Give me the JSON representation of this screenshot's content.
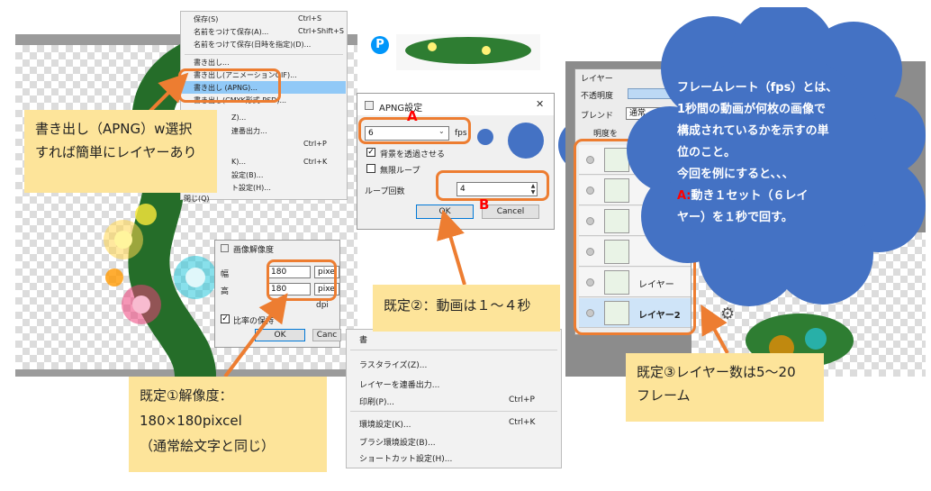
{
  "file_menu_top": {
    "items": [
      {
        "label": "保存(S)",
        "shortcut": "Ctrl+S"
      },
      {
        "label": "名前をつけて保存(A)...",
        "shortcut": "Ctrl+Shift+S"
      },
      {
        "label": "名前をつけて保存(日時を指定)(D)...",
        "shortcut": ""
      },
      {
        "label": "書き出し...",
        "shortcut": ""
      },
      {
        "label": "書き出し(アニメーションGIF)...",
        "shortcut": ""
      },
      {
        "label": "書き出し (APNG)...",
        "shortcut": ""
      },
      {
        "label": "書き出し(CMYK形式 PSD)...",
        "shortcut": ""
      },
      {
        "label": "Z)...",
        "shortcut": ""
      },
      {
        "label": "連番出力...",
        "shortcut": ""
      },
      {
        "label": "",
        "shortcut": "Ctrl+P"
      },
      {
        "label": "K)...",
        "shortcut": "Ctrl+K"
      },
      {
        "label": "設定(B)...",
        "shortcut": ""
      },
      {
        "label": "ト設定(H)...",
        "shortcut": ""
      },
      {
        "label": "閉じ(Q)",
        "shortcut": ""
      }
    ]
  },
  "file_menu_bottom": {
    "items": [
      {
        "label": "書",
        "shortcut": ""
      },
      {
        "label": "ラスタライズ(Z)...",
        "shortcut": ""
      },
      {
        "label": "レイヤーを連番出力...",
        "shortcut": ""
      },
      {
        "label": "印刷(P)...",
        "shortcut": "Ctrl+P"
      },
      {
        "label": "環境設定(K)...",
        "shortcut": "Ctrl+K"
      },
      {
        "label": "ブラシ環境設定(B)...",
        "shortcut": ""
      },
      {
        "label": "ショートカット設定(H)...",
        "shortcut": ""
      }
    ]
  },
  "apng_dialog": {
    "title": "APNG設定",
    "close": "✕",
    "fps_value": "6",
    "fps_unit": "fps",
    "bg_transparent": "背景を透過させる",
    "infinite_loop": "無限ループ",
    "loop_count_label": "ループ回数",
    "loop_count_value": "4",
    "ok": "OK",
    "cancel": "Cancel"
  },
  "resize_dialog": {
    "title": "画像解像度",
    "width_label": "幅",
    "height_label": "高",
    "width_value": "180",
    "height_value": "180",
    "unit": "pixel",
    "dpi_unit": "dpi",
    "keep_ratio": "比率の保持",
    "ok": "OK",
    "cancel": "Canc"
  },
  "layer_panel": {
    "title": "レイヤー",
    "opacity_label": "不透明度",
    "blend_label": "ブレンド",
    "blend_value": "通常",
    "fps_partial": "明度を",
    "rows": [
      {
        "name": ""
      },
      {
        "name": ""
      },
      {
        "name": ""
      },
      {
        "name": ""
      },
      {
        "name": "レイヤー"
      },
      {
        "name": "レイヤー2"
      }
    ]
  },
  "annotations": {
    "note1": [
      "書き出し（APNG）w選択",
      "すれば簡単にレイヤーあり"
    ],
    "note2": [
      "既定①解像度：",
      "180×180pixcel",
      "（通常絵文字と同じ）"
    ],
    "note3": [
      "既定②：動画は１～４秒"
    ],
    "note4": [
      "既定③レイヤー数は5～20",
      "フレーム"
    ],
    "label_a": "A",
    "label_b": "B"
  },
  "cloud": {
    "lines": [
      "フレームレート（fps）とは、",
      "1秒間の動画が何枚の画像で",
      "構成されているかを示すの単",
      "位のこと。",
      "今回を例にすると、、、",
      "動き１セット（６レイ",
      "ヤー）を１秒で回す。"
    ],
    "a_prefix": "A:"
  },
  "colors": {
    "highlight": "#ed7d31",
    "note_bg": "#fde49a",
    "cloud": "#4472c4",
    "menu_selected": "#91c9f7",
    "red_label": "#ff0000"
  }
}
